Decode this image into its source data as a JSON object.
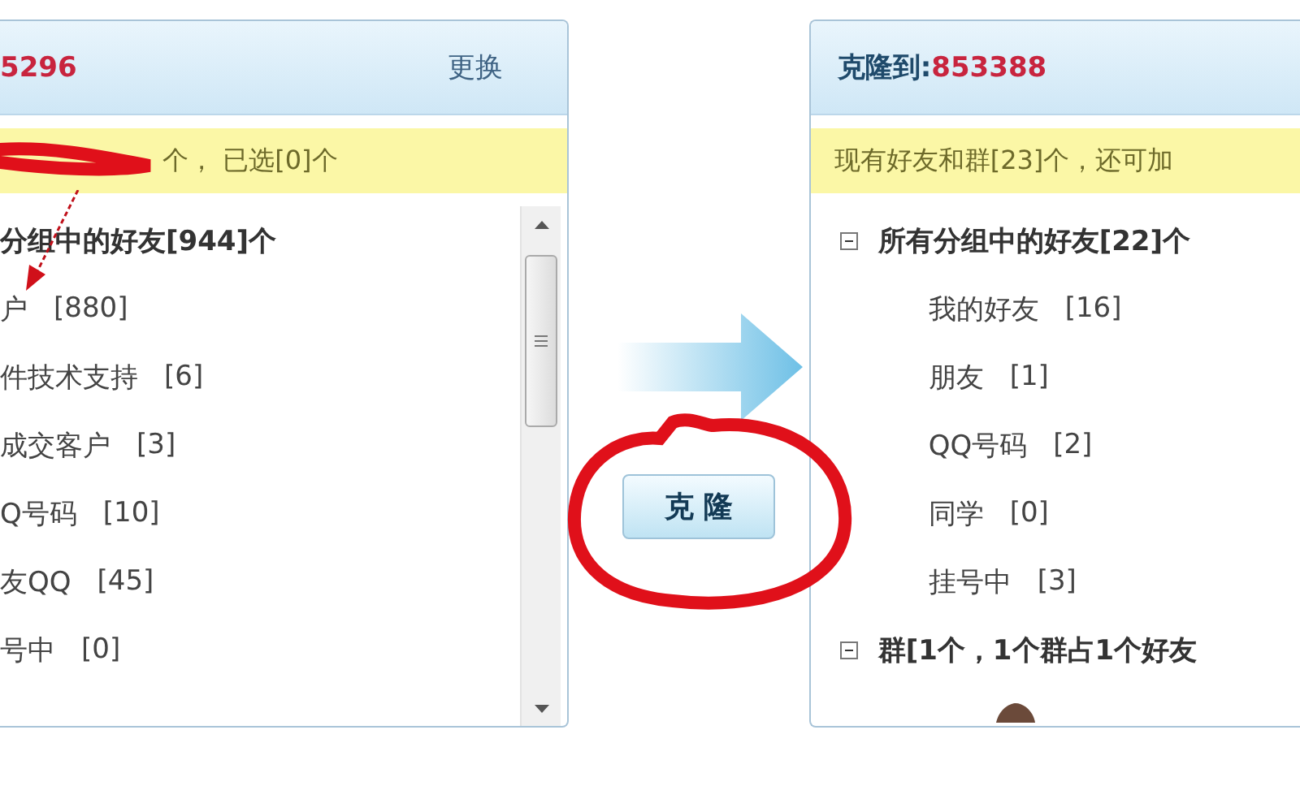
{
  "source": {
    "title_number": "5296",
    "change_link": "更换",
    "notice": "个， 已选[0]个",
    "tree": [
      {
        "label": "分组中的好友[944]个",
        "children": [
          {
            "label": "户",
            "count": "[880]"
          },
          {
            "label": "件技术支持",
            "count": "[6]"
          },
          {
            "label": "成交客户",
            "count": "[3]"
          },
          {
            "label": "Q号码",
            "count": "[10]"
          },
          {
            "label": "友QQ",
            "count": "[45]"
          },
          {
            "label": "号中",
            "count": "[0]"
          }
        ]
      }
    ]
  },
  "clone_button": "克 隆",
  "target": {
    "title_label": "克隆到:",
    "title_number": "853388",
    "notice": "现有好友和群[23]个，还可加",
    "tree": [
      {
        "label": "所有分组中的好友[22]个",
        "expanded": true,
        "children": [
          {
            "label": "我的好友",
            "count": "[16]"
          },
          {
            "label": "朋友",
            "count": "[1]"
          },
          {
            "label": "QQ号码",
            "count": "[2]"
          },
          {
            "label": "同学",
            "count": "[0]"
          },
          {
            "label": "挂号中",
            "count": "[3]"
          }
        ]
      },
      {
        "label": "群[1个，1个群占1个好友",
        "expanded": true
      }
    ]
  }
}
